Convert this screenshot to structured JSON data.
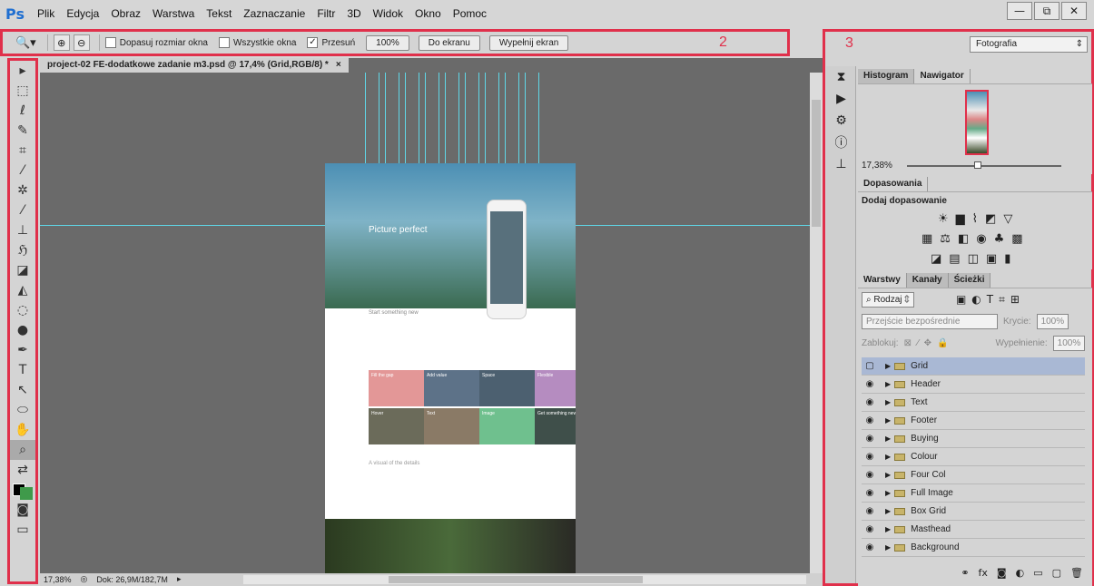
{
  "app": {
    "logo": "Ps",
    "menus": [
      "Plik",
      "Edycja",
      "Obraz",
      "Warstwa",
      "Tekst",
      "Zaznaczanie",
      "Filtr",
      "3D",
      "Widok",
      "Okno",
      "Pomoc"
    ]
  },
  "window_controls": {
    "minimize": "—",
    "restore": "⧉",
    "close": "✕"
  },
  "options_bar": {
    "fit_window": "Dopasuj rozmiar okna",
    "all_windows": "Wszystkie okna",
    "scrubby": "Przesuń",
    "btn_100": "100%",
    "btn_fit": "Do ekranu",
    "btn_fill": "Wypełnij ekran"
  },
  "annotations": {
    "a1": "1",
    "a2": "2",
    "a3": "3"
  },
  "document": {
    "tab_title": "project-02 FE-dodatkowe zadanie m3.psd @ 17,4% (Grid,RGB/8) *",
    "tab_close": "×",
    "status_zoom": "17,38%",
    "status_doc": "Dok: 26,9M/182,7M"
  },
  "canvas": {
    "hero_title": "Picture perfect",
    "section_text": "Start something new",
    "tiles": [
      "Fill the gap",
      "Add value",
      "Space",
      "Flexible",
      "Hover",
      "Text",
      "Image",
      "Get something new"
    ],
    "details": "A visual of the details"
  },
  "workspace": "Fotografia",
  "navigator": {
    "tabs": [
      "Histogram",
      "Nawigator"
    ],
    "zoom": "17,38%"
  },
  "adjustments": {
    "tab": "Dopasowania",
    "title": "Dodaj dopasowanie"
  },
  "layers": {
    "tabs": [
      "Warstwy",
      "Kanały",
      "Ścieżki"
    ],
    "filter": "Rodzaj",
    "blend": "Przejście bezpośrednie",
    "opacity_label": "Krycie:",
    "opacity": "100%",
    "lock_label": "Zablokuj:",
    "fill_label": "Wypełnienie:",
    "fill": "100%",
    "items": [
      {
        "name": "Grid",
        "visible": false,
        "selected": true
      },
      {
        "name": "Header",
        "visible": true
      },
      {
        "name": "Text",
        "visible": true
      },
      {
        "name": "Footer",
        "visible": true
      },
      {
        "name": "Buying",
        "visible": true
      },
      {
        "name": "Colour",
        "visible": true
      },
      {
        "name": "Four Col",
        "visible": true
      },
      {
        "name": "Full Image",
        "visible": true
      },
      {
        "name": "Box Grid",
        "visible": true
      },
      {
        "name": "Masthead",
        "visible": true
      },
      {
        "name": "Background",
        "visible": true
      }
    ]
  },
  "colors": {
    "annotation": "#e0304b",
    "guide": "#5fd6e6",
    "selection": "#a9b8d4"
  }
}
